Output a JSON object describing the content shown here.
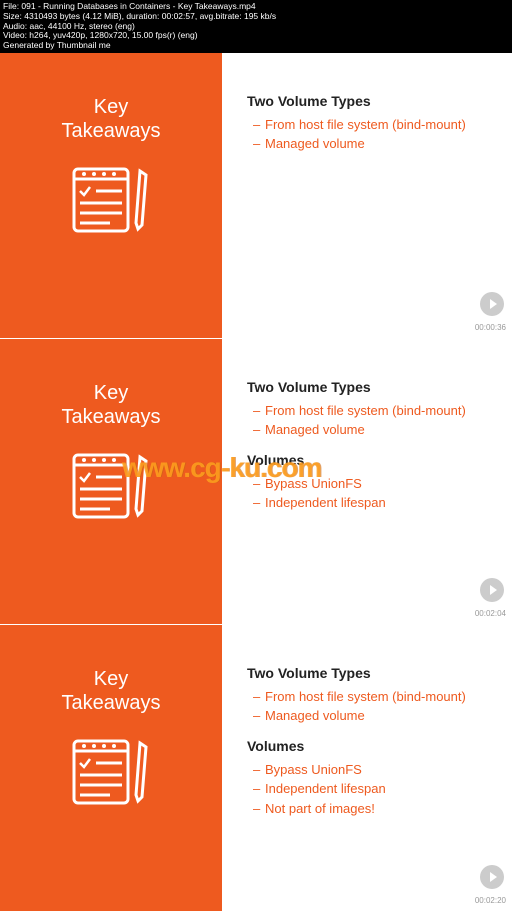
{
  "metadata": {
    "line1": "File: 091 - Running Databases in Containers - Key Takeaways.mp4",
    "line2": "Size: 4310493 bytes (4.12 MiB), duration: 00:02:57, avg.bitrate: 195 kb/s",
    "line3": "Audio: aac, 44100 Hz, stereo (eng)",
    "line4": "Video: h264, yuv420p, 1280x720, 15.00 fps(r) (eng)",
    "line5": "Generated by Thumbnail me"
  },
  "sidebar": {
    "title_line1": "Key",
    "title_line2": "Takeaways"
  },
  "slides": [
    {
      "sections": [
        {
          "heading": "Two Volume Types",
          "items": [
            "From host file system (bind-mount)",
            "Managed volume"
          ]
        }
      ],
      "timestamp": "00:00:36"
    },
    {
      "sections": [
        {
          "heading": "Two Volume Types",
          "items": [
            "From host file system (bind-mount)",
            "Managed volume"
          ]
        },
        {
          "heading": "Volumes",
          "items": [
            "Bypass UnionFS",
            "Independent lifespan"
          ]
        }
      ],
      "timestamp": "00:02:04"
    },
    {
      "sections": [
        {
          "heading": "Two Volume Types",
          "items": [
            "From host file system (bind-mount)",
            "Managed volume"
          ]
        },
        {
          "heading": "Volumes",
          "items": [
            "Bypass UnionFS",
            "Independent lifespan",
            "Not part of images!"
          ]
        }
      ],
      "timestamp": "00:02:20"
    }
  ],
  "watermark": "www.cg-ku.com"
}
